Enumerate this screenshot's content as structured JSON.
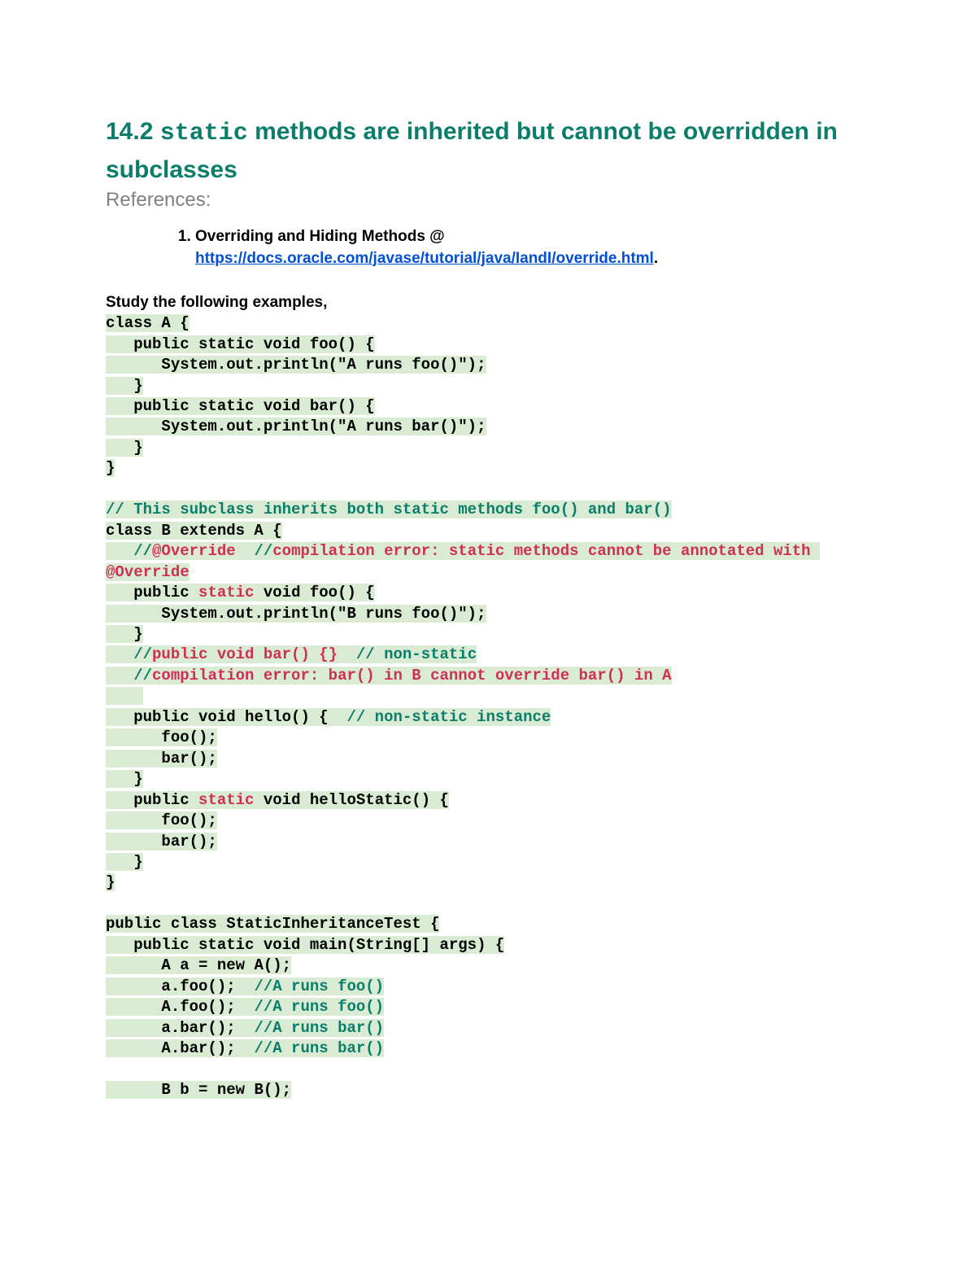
{
  "heading": {
    "number": "14.2",
    "code": "static",
    "rest": "methods are inherited but cannot be overridden in subclasses"
  },
  "references_label": "References:",
  "references": [
    {
      "prefix": "Overriding and Hiding Methods @ ",
      "link_text": "https://docs.oracle.com/javase/tutorial/java/IandI/override.html",
      "suffix": "."
    }
  ],
  "study_label": "Study the following examples,",
  "code_lines": [
    {
      "indent": 0,
      "highlighted": true,
      "segments": [
        {
          "text": "class A {",
          "class": ""
        }
      ]
    },
    {
      "indent": 1,
      "highlighted": true,
      "segments": [
        {
          "text": "public static void foo() {",
          "class": ""
        }
      ]
    },
    {
      "indent": 2,
      "highlighted": true,
      "segments": [
        {
          "text": "System.out.println(\"A runs foo()\");",
          "class": ""
        }
      ]
    },
    {
      "indent": 1,
      "highlighted": true,
      "segments": [
        {
          "text": "}",
          "class": ""
        }
      ]
    },
    {
      "indent": 1,
      "highlighted": true,
      "segments": [
        {
          "text": "public static void bar() {",
          "class": ""
        }
      ]
    },
    {
      "indent": 2,
      "highlighted": true,
      "segments": [
        {
          "text": "System.out.println(\"A runs bar()\");",
          "class": ""
        }
      ]
    },
    {
      "indent": 1,
      "highlighted": true,
      "segments": [
        {
          "text": "}",
          "class": ""
        }
      ]
    },
    {
      "indent": 0,
      "highlighted": true,
      "segments": [
        {
          "text": "}",
          "class": ""
        }
      ]
    },
    {
      "indent": 0,
      "highlighted": false,
      "segments": []
    },
    {
      "indent": 0,
      "highlighted": true,
      "segments": [
        {
          "text": "// This subclass inherits both static methods foo() and bar()",
          "class": "grn"
        }
      ]
    },
    {
      "indent": 0,
      "highlighted": true,
      "segments": [
        {
          "text": "class B extends A {",
          "class": ""
        }
      ]
    },
    {
      "indent": 1,
      "highlighted": true,
      "segments": [
        {
          "text": "//",
          "class": "grn"
        },
        {
          "text": "@Override  ",
          "class": "red"
        },
        {
          "text": "//",
          "class": "grn"
        },
        {
          "text": "compilation error: static methods cannot be annotated with ",
          "class": "red"
        }
      ],
      "continue_next": true
    },
    {
      "indent": 0,
      "highlighted": true,
      "segments": [
        {
          "text": "@Override",
          "class": "red"
        }
      ]
    },
    {
      "indent": 1,
      "highlighted": true,
      "segments": [
        {
          "text": "public ",
          "class": ""
        },
        {
          "text": "static",
          "class": "red"
        },
        {
          "text": " void foo() {",
          "class": ""
        }
      ]
    },
    {
      "indent": 2,
      "highlighted": true,
      "segments": [
        {
          "text": "System.out.println(\"B runs foo()\");",
          "class": ""
        }
      ]
    },
    {
      "indent": 1,
      "highlighted": true,
      "segments": [
        {
          "text": "}",
          "class": ""
        }
      ]
    },
    {
      "indent": 1,
      "highlighted": true,
      "segments": [
        {
          "text": "//",
          "class": "grn"
        },
        {
          "text": "public void bar() {}  ",
          "class": "red"
        },
        {
          "text": "// non-static",
          "class": "grn"
        }
      ]
    },
    {
      "indent": 1,
      "highlighted": true,
      "segments": [
        {
          "text": "//",
          "class": "grn"
        },
        {
          "text": "compilation error: bar() in B cannot override bar() in A",
          "class": "red"
        }
      ]
    },
    {
      "indent": 1,
      "highlighted": true,
      "segments": []
    },
    {
      "indent": 1,
      "highlighted": true,
      "segments": [
        {
          "text": "public void hello() {  ",
          "class": ""
        },
        {
          "text": "// non-static instance",
          "class": "grn"
        }
      ]
    },
    {
      "indent": 2,
      "highlighted": true,
      "segments": [
        {
          "text": "foo();",
          "class": ""
        }
      ]
    },
    {
      "indent": 2,
      "highlighted": true,
      "segments": [
        {
          "text": "bar();",
          "class": ""
        }
      ]
    },
    {
      "indent": 1,
      "highlighted": true,
      "segments": [
        {
          "text": "}",
          "class": ""
        }
      ]
    },
    {
      "indent": 1,
      "highlighted": true,
      "segments": [
        {
          "text": "public ",
          "class": ""
        },
        {
          "text": "static",
          "class": "red"
        },
        {
          "text": " void helloStatic() {",
          "class": ""
        }
      ]
    },
    {
      "indent": 2,
      "highlighted": true,
      "segments": [
        {
          "text": "foo();",
          "class": ""
        }
      ]
    },
    {
      "indent": 2,
      "highlighted": true,
      "segments": [
        {
          "text": "bar();",
          "class": ""
        }
      ]
    },
    {
      "indent": 1,
      "highlighted": true,
      "segments": [
        {
          "text": "}",
          "class": ""
        }
      ]
    },
    {
      "indent": 0,
      "highlighted": true,
      "segments": [
        {
          "text": "}",
          "class": ""
        }
      ]
    },
    {
      "indent": 0,
      "highlighted": false,
      "segments": []
    },
    {
      "indent": 0,
      "highlighted": true,
      "segments": [
        {
          "text": "public class StaticInheritanceTest {",
          "class": ""
        }
      ]
    },
    {
      "indent": 1,
      "highlighted": true,
      "segments": [
        {
          "text": "public static void main(String[] args) {",
          "class": ""
        }
      ]
    },
    {
      "indent": 2,
      "highlighted": true,
      "segments": [
        {
          "text": "A a = new A();",
          "class": ""
        }
      ]
    },
    {
      "indent": 2,
      "highlighted": true,
      "segments": [
        {
          "text": "a.foo();  ",
          "class": ""
        },
        {
          "text": "//A runs foo()",
          "class": "grn"
        }
      ]
    },
    {
      "indent": 2,
      "highlighted": true,
      "segments": [
        {
          "text": "A.foo();  ",
          "class": ""
        },
        {
          "text": "//A runs foo()",
          "class": "grn"
        }
      ]
    },
    {
      "indent": 2,
      "highlighted": true,
      "segments": [
        {
          "text": "a.bar();  ",
          "class": ""
        },
        {
          "text": "//A runs bar()",
          "class": "grn"
        }
      ]
    },
    {
      "indent": 2,
      "highlighted": true,
      "segments": [
        {
          "text": "A.bar();  ",
          "class": ""
        },
        {
          "text": "//A runs bar()",
          "class": "grn"
        }
      ]
    },
    {
      "indent": 0,
      "highlighted": false,
      "segments": []
    },
    {
      "indent": 2,
      "highlighted": true,
      "segments": [
        {
          "text": "B b = new B();",
          "class": ""
        }
      ]
    }
  ]
}
